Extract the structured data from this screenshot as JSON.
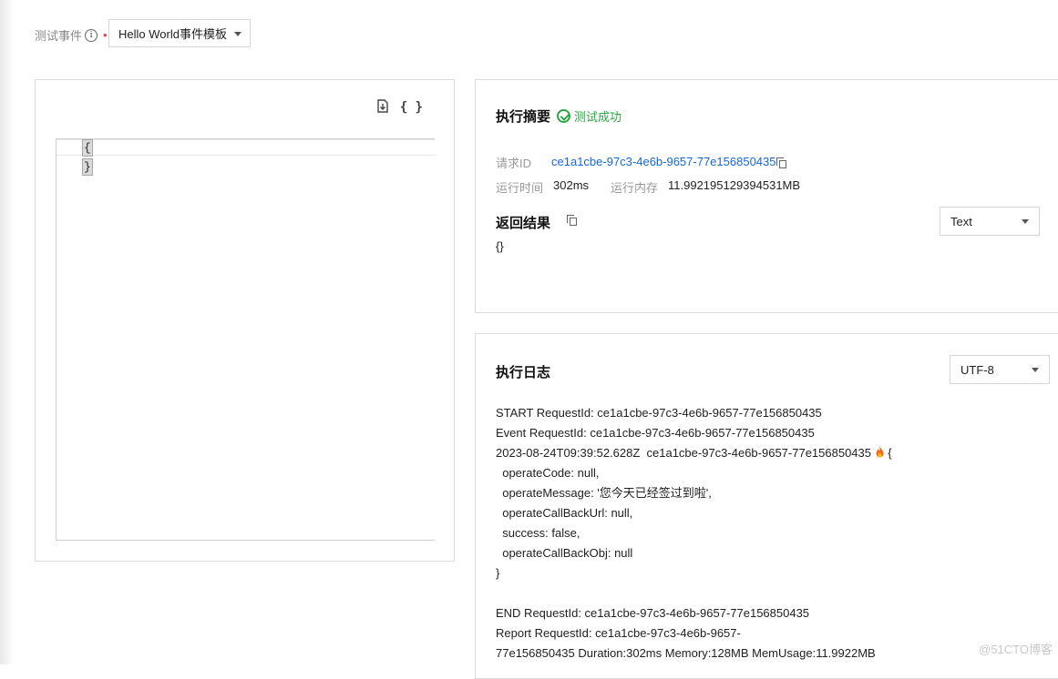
{
  "event": {
    "label": "测试事件",
    "info_icon": "info-icon",
    "required_mark": "•",
    "selected": "Hello World事件模板"
  },
  "editor": {
    "tools": [
      "import-icon",
      "format-braces-icon"
    ],
    "format_glyph": "{ }",
    "lines": [
      "{",
      "}"
    ]
  },
  "summary": {
    "title": "执行摘要",
    "status": "测试成功",
    "request_id_label": "请求ID",
    "request_id": "ce1a1cbe-97c3-4e6b-9657-77e156850435",
    "run_time_label": "运行时间",
    "run_time": "302ms",
    "run_memory_label": "运行内存",
    "run_memory": "11.992195129394531MB",
    "result_title": "返回结果",
    "result_format": "Text",
    "result_value": "{}"
  },
  "log": {
    "title": "执行日志",
    "encoding": "UTF-8",
    "lines": [
      "START RequestId: ce1a1cbe-97c3-4e6b-9657-77e156850435",
      "Event RequestId: ce1a1cbe-97c3-4e6b-9657-77e156850435",
      "2023-08-24T09:39:52.628Z  ce1a1cbe-97c3-4e6b-9657-77e156850435 ",
      "  operateCode: null,",
      "  operateMessage: '您今天已经签过到啦',",
      "  operateCallBackUrl: null,",
      "  success: false,",
      "  operateCallBackObj: null",
      "}",
      "END RequestId: ce1a1cbe-97c3-4e6b-9657-77e156850435",
      "Report RequestId: ce1a1cbe-97c3-4e6b-9657-",
      "77e156850435 Duration:302ms Memory:128MB MemUsage:11.9922MB"
    ],
    "line3_suffix": " {"
  },
  "watermark": "@51CTO博客",
  "colors": {
    "success": "#29a745",
    "link": "#1668dc",
    "required": "#e54545"
  }
}
